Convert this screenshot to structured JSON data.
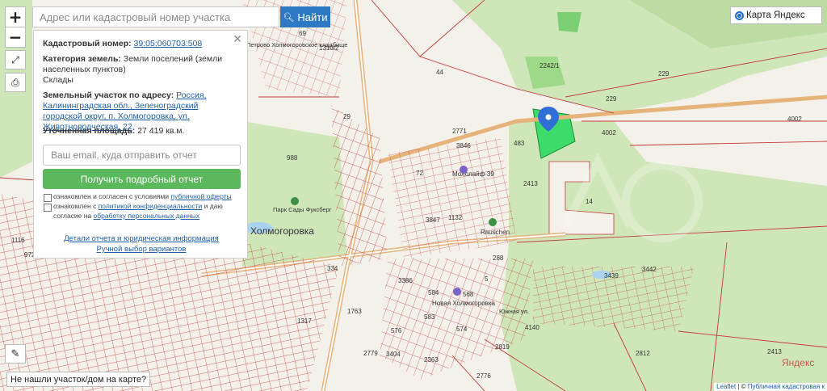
{
  "search": {
    "placeholder": "Адрес или кадастровый номер участка",
    "button_label": "Найти"
  },
  "zoom": {
    "in": "+",
    "out": "−"
  },
  "panel": {
    "cadastral_label": "Кадастровый номер:",
    "cadastral_value": "39:05:060703:508",
    "category_label": "Категория земель:",
    "category_value": "Земли поселений (земли населенных пунктов)",
    "category_use": "Склады",
    "address_label": "Земельный участок по адресу:",
    "address_value": "Россия, Калининградская обл., Зеленоградский городской округ, п. Холмогоровка, ул. Животноводческая, 22",
    "area_label": "Уточненная площадь:",
    "area_value": "27 419 кв.м.",
    "email_placeholder": "Ваш email, куда отправить отчет",
    "report_button": "Получить подробный отчет",
    "agree_offer_prefix": "ознакомлен и согласен с условиями ",
    "agree_offer_link": "публичной оферты",
    "agree_privacy_prefix": "ознакомлен с ",
    "agree_privacy_link": "политикой конфиденциальности",
    "agree_privacy_mid": " и даю согласие на ",
    "agree_privacy_link2": "обработку персональных данных",
    "details_link": "Детали отчета и юридическая информация",
    "manual_link": "Ручной выбор вариантов"
  },
  "layer_selector": {
    "label": "Карта Яндекс"
  },
  "not_found_label": "Не нашли участок/дом на карте?",
  "attribution": {
    "leaflet": "Leaflet",
    "sep": " | © ",
    "pkk": "Публичная кадастровая к"
  },
  "watermark": "Яндекс",
  "map_labels": {
    "town": "Холмогоровка",
    "cemetery": "Петрово Холмогоровское кладбище",
    "park": "Парк Сады Фуксберг",
    "poi_molo": "Мололайф-39",
    "poi_rauschen": "Rauschen",
    "poi_novaya": "Новая Холмогоровка",
    "street_south": "Южная ул.",
    "parcels": [
      "69",
      "1310/2",
      "44",
      "2242/1",
      "229",
      "229",
      "4002",
      "4002",
      "29",
      "988",
      "483",
      "3846",
      "2771",
      "72",
      "2413",
      "14",
      "3847",
      "1132",
      "288",
      "584",
      "568",
      "583",
      "574",
      "576",
      "3386",
      "3439",
      "3442",
      "1116",
      "972",
      "1317",
      "2779",
      "3404",
      "2363",
      "2819",
      "2776",
      "2413",
      "2812",
      "4140",
      "334",
      "1763",
      "5"
    ]
  },
  "colors": {
    "accent": "#2f78c4",
    "green_btn": "#5cb85c",
    "parcel_line": "#c23a3a",
    "forest": "#cfe6b8",
    "selected_parcel": "#3ddc6a",
    "marker": "#2f6fd6"
  }
}
